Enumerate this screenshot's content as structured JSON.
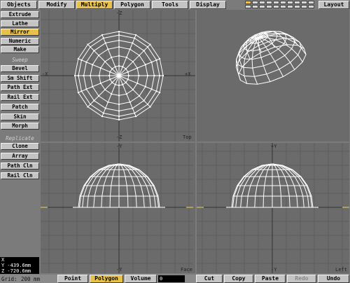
{
  "tabs": [
    {
      "label": "Objects",
      "active": false
    },
    {
      "label": "Modify",
      "active": false
    },
    {
      "label": "Multiply",
      "active": true
    },
    {
      "label": "Polygon",
      "active": false
    },
    {
      "label": "Tools",
      "active": false
    },
    {
      "label": "Display",
      "active": false
    }
  ],
  "layout_button": "Layout",
  "sidebar": {
    "group1": [
      "Extrude",
      "Lathe",
      "Mirror",
      "Numeric",
      "Make"
    ],
    "active_item": "Mirror",
    "header_sweep": "Sweep",
    "group2": [
      "Bevel",
      "Sm Shift",
      "Path Ext",
      "Rail Ext",
      "Patch",
      "Skin",
      "Morph"
    ],
    "header_replicate": "Replicate",
    "group3": [
      "Clone",
      "Array",
      "Path Cln",
      "Rail Cln"
    ]
  },
  "viewports": {
    "top": {
      "axis_top": "-Z",
      "axis_left": "-X",
      "axis_right": "+X",
      "axis_bottom": "-Z",
      "corner": "Top"
    },
    "face": {
      "axis_top": "-Y",
      "axis_bottom": "-Y",
      "corner": "Face"
    },
    "left": {
      "axis_top": "+Y",
      "axis_bottom": "-Y",
      "corner": "Left"
    }
  },
  "coords": {
    "x": "X",
    "y": "Y -439.6mm",
    "z": "Z -720.6mm"
  },
  "bottom": {
    "grid_label": "Grid:",
    "grid_value": "200 mm",
    "modes": [
      "Point",
      "Polygon",
      "Volume"
    ],
    "active_mode": "Polygon",
    "count": "0",
    "actions": [
      "Cut",
      "Copy",
      "Paste",
      "Redo",
      "Undo"
    ],
    "disabled_action": "Redo"
  },
  "colors": {
    "active": "#e8c14a",
    "button": "#c4c4c4",
    "viewport": "#6b6b6b",
    "wire": "#ffffff"
  }
}
